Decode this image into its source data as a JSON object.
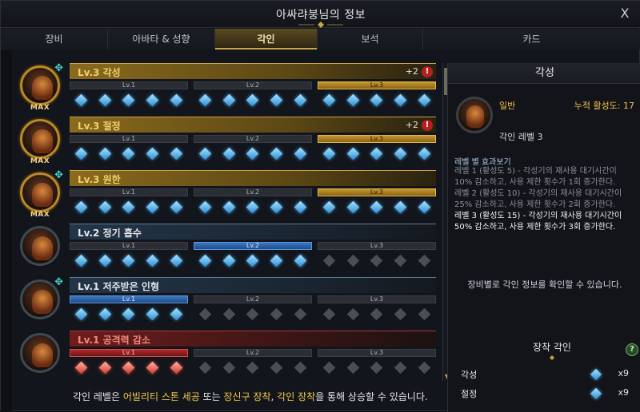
{
  "window": {
    "title": "아싸랴붕님의 정보",
    "close_glyph": "X"
  },
  "tabs": [
    {
      "label": "장비"
    },
    {
      "label": "아바타 & 성향"
    },
    {
      "label": "각인"
    },
    {
      "label": "보석"
    },
    {
      "label": "카드"
    }
  ],
  "engravings": [
    {
      "name": "Lv.3 각성",
      "plus": "+2",
      "badge": "MAX",
      "state": "gold",
      "level": 3
    },
    {
      "name": "Lv.3 절정",
      "plus": "+2",
      "badge": "MAX",
      "state": "gold",
      "level": 3
    },
    {
      "name": "Lv.3 원한",
      "plus": "",
      "badge": "MAX",
      "state": "gold",
      "level": 3
    },
    {
      "name": "Lv.2 정기 흡수",
      "plus": "",
      "badge": "",
      "state": "blue",
      "level": 2
    },
    {
      "name": "Lv.1 저주받은 인형",
      "plus": "",
      "badge": "",
      "state": "blue",
      "level": 1
    },
    {
      "name": "Lv.1 공격력 감소",
      "plus": "",
      "badge": "",
      "state": "red",
      "level": 1
    }
  ],
  "level_labels": [
    "Lv.1",
    "Lv.2",
    "Lv.3"
  ],
  "footer": {
    "prefix": "각인 레벨은 ",
    "hl1": "어빌리티 스톤 세공",
    "mid": " 또는 ",
    "hl2": "장신구 장착",
    "mid2": ", ",
    "hl3": "각인 장착",
    "suffix": "을 통해 상승할 수 있습니다."
  },
  "detail": {
    "title": "각성",
    "type": "일반",
    "activation": "누적 활성도: 17",
    "engrave_level": "각인 레벨 3",
    "effects_head": "레벨 별 효과보기",
    "effects": [
      "레벨 1 (활성도 5) - 각성기의 재사용 대기시간이 10% 감소하고, 사용 제한 횟수가 1회 증가한다.",
      "레벨 2 (활성도 10) - 각성기의 재사용 대기시간이 25% 감소하고, 사용 제한 횟수가 2회 증가한다.",
      "레벨 3 (활성도 15) - 각성기의 재사용 대기시간이 50% 감소하고, 사용 제한 횟수가 3회 증가한다."
    ],
    "info_message": "장비별로 각인 정보를 확인할 수 있습니다.",
    "equip_head": "장착 각인",
    "help_glyph": "?",
    "equipped": [
      {
        "name": "각성",
        "count": "x9"
      },
      {
        "name": "절정",
        "count": "x9"
      }
    ]
  },
  "colors": {
    "gold": "#c9a44a",
    "blue": "#3a78c4",
    "red": "#b02a2a",
    "gem": "#2c8fd6"
  }
}
